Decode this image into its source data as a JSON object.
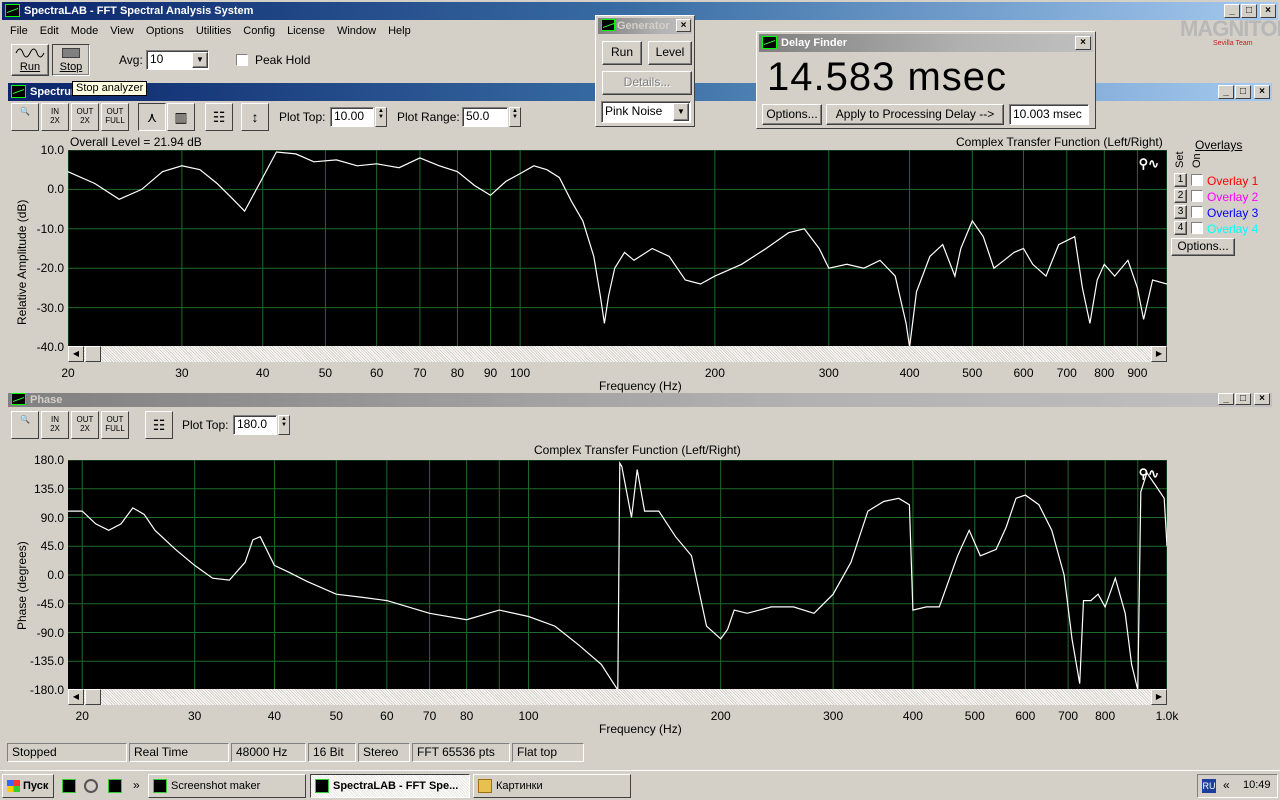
{
  "app": {
    "title": "SpectraLAB - FFT Spectral Analysis System",
    "logo": "MAGNITOLA",
    "logo_sub": "Sevilla Team"
  },
  "menu": [
    "File",
    "Edit",
    "Mode",
    "View",
    "Options",
    "Utilities",
    "Config",
    "License",
    "Window",
    "Help"
  ],
  "toolbar": {
    "run_label": "Run",
    "stop_label": "Stop",
    "avg_label": "Avg:",
    "avg_value": "10",
    "peak_hold_label": "Peak Hold",
    "tooltip": "Stop analyzer"
  },
  "generator": {
    "title": "Generator",
    "run_label": "Run",
    "level_label": "Level",
    "details_label": "Details...",
    "noise_value": "Pink Noise"
  },
  "delay_finder": {
    "title": "Delay Finder",
    "value": "14.583 msec",
    "options_label": "Options...",
    "apply_label": "Apply to Processing Delay -->",
    "processing_delay": "10.003 msec"
  },
  "spectrum": {
    "title": "Spectrum",
    "plot_top_label": "Plot Top:",
    "plot_top_value": "10.00",
    "plot_range_label": "Plot Range:",
    "plot_range_value": "50.0",
    "overall_level": "Overall Level = 21.94 dB",
    "subtitle": "Complex Transfer Function (Left/Right)",
    "overlays": {
      "title": "Overlays",
      "set_label": "Set",
      "on_label": "On",
      "items": [
        {
          "num": "1",
          "label": "Overlay 1",
          "color": "#ff0000"
        },
        {
          "num": "2",
          "label": "Overlay 2",
          "color": "#ff00ff"
        },
        {
          "num": "3",
          "label": "Overlay 3",
          "color": "#0000ff"
        },
        {
          "num": "4",
          "label": "Overlay 4",
          "color": "#00ffff"
        }
      ],
      "options_label": "Options..."
    }
  },
  "phase": {
    "title": "Phase",
    "plot_top_label": "Plot Top:",
    "plot_top_value": "180.0",
    "subtitle": "Complex Transfer Function (Left/Right)"
  },
  "status": [
    "Stopped",
    "Real Time",
    "48000 Hz",
    "16 Bit",
    "Stereo",
    "FFT 65536 pts",
    "Flat top"
  ],
  "taskbar": {
    "start_label": "Пуск",
    "tasks": [
      "Screenshot maker",
      "SpectraLAB - FFT Spe...",
      "Картинки"
    ],
    "lang": "RU",
    "clock": "10:49"
  },
  "chart_data": [
    {
      "type": "line",
      "xlabel": "Frequency (Hz)",
      "ylabel": "Relative Amplitude (dB)",
      "x_scale": "log",
      "xlim": [
        20,
        1000
      ],
      "ylim": [
        -40,
        10
      ],
      "grid": true,
      "x_ticks": [
        "20",
        "30",
        "40",
        "50",
        "60",
        "70",
        "80",
        "90",
        "100",
        "200",
        "300",
        "400",
        "500",
        "600",
        "700",
        "800",
        "900"
      ],
      "y_ticks": [
        "10.0",
        "0.0",
        "-10.0",
        "-20.0",
        "-30.0",
        "-40.0"
      ],
      "points": [
        [
          20,
          4.5
        ],
        [
          22,
          1.5
        ],
        [
          24,
          -2.5
        ],
        [
          26,
          0
        ],
        [
          28,
          4.5
        ],
        [
          30,
          6
        ],
        [
          32,
          5
        ],
        [
          34,
          1.5
        ],
        [
          36,
          -2.5
        ],
        [
          37.5,
          -5.5
        ],
        [
          40,
          3
        ],
        [
          42,
          9.5
        ],
        [
          45,
          9
        ],
        [
          48,
          7
        ],
        [
          52,
          7.5
        ],
        [
          56,
          6
        ],
        [
          60,
          6.5
        ],
        [
          65,
          5.5
        ],
        [
          70,
          8
        ],
        [
          75,
          6
        ],
        [
          80,
          4.5
        ],
        [
          85,
          1
        ],
        [
          90,
          -1.5
        ],
        [
          95,
          2
        ],
        [
          100,
          4
        ],
        [
          105,
          6
        ],
        [
          110,
          5
        ],
        [
          115,
          3
        ],
        [
          120,
          -3
        ],
        [
          125,
          -8
        ],
        [
          130,
          -17
        ],
        [
          133,
          -27
        ],
        [
          135,
          -34
        ],
        [
          137,
          -27
        ],
        [
          140,
          -20
        ],
        [
          145,
          -16
        ],
        [
          150,
          -18
        ],
        [
          160,
          -15
        ],
        [
          170,
          -17
        ],
        [
          180,
          -23
        ],
        [
          190,
          -24
        ],
        [
          200,
          -22
        ],
        [
          220,
          -19
        ],
        [
          240,
          -15
        ],
        [
          260,
          -11
        ],
        [
          275,
          -10
        ],
        [
          290,
          -15
        ],
        [
          300,
          -20
        ],
        [
          320,
          -19
        ],
        [
          340,
          -20
        ],
        [
          360,
          -18
        ],
        [
          380,
          -22
        ],
        [
          395,
          -34
        ],
        [
          400,
          -40
        ],
        [
          410,
          -26
        ],
        [
          430,
          -17
        ],
        [
          450,
          -14
        ],
        [
          470,
          -22
        ],
        [
          480,
          -15
        ],
        [
          500,
          -8
        ],
        [
          520,
          -12
        ],
        [
          540,
          -20
        ],
        [
          560,
          -18
        ],
        [
          580,
          -16
        ],
        [
          600,
          -15
        ],
        [
          620,
          -19
        ],
        [
          650,
          -22
        ],
        [
          680,
          -14
        ],
        [
          720,
          -12
        ],
        [
          740,
          -25
        ],
        [
          760,
          -34
        ],
        [
          780,
          -23
        ],
        [
          800,
          -19
        ],
        [
          830,
          -22
        ],
        [
          870,
          -18
        ],
        [
          900,
          -25
        ],
        [
          920,
          -33
        ],
        [
          950,
          -23
        ],
        [
          1000,
          -24
        ]
      ]
    },
    {
      "type": "line",
      "xlabel": "Frequency (Hz)",
      "ylabel": "Phase (degrees)",
      "x_scale": "log",
      "xlim": [
        19,
        1000
      ],
      "ylim": [
        -180,
        180
      ],
      "grid": true,
      "x_ticks": [
        "20",
        "30",
        "40",
        "50",
        "60",
        "70",
        "80",
        "100",
        "200",
        "300",
        "400",
        "500",
        "600",
        "700",
        "800",
        "1.0k"
      ],
      "y_ticks": [
        "180.0",
        "135.0",
        "90.0",
        "45.0",
        "0.0",
        "-45.0",
        "-90.0",
        "-135.0",
        "-180.0"
      ],
      "points": [
        [
          19,
          100
        ],
        [
          20,
          100
        ],
        [
          21,
          80
        ],
        [
          22,
          70
        ],
        [
          23,
          80
        ],
        [
          24,
          105
        ],
        [
          25,
          95
        ],
        [
          26,
          70
        ],
        [
          28,
          40
        ],
        [
          30,
          15
        ],
        [
          32,
          -5
        ],
        [
          34,
          -8
        ],
        [
          36,
          20
        ],
        [
          37,
          55
        ],
        [
          38,
          60
        ],
        [
          40,
          15
        ],
        [
          42,
          5
        ],
        [
          45,
          -10
        ],
        [
          50,
          -30
        ],
        [
          55,
          -35
        ],
        [
          60,
          -40
        ],
        [
          70,
          -60
        ],
        [
          80,
          -70
        ],
        [
          90,
          -55
        ],
        [
          100,
          -65
        ],
        [
          110,
          -80
        ],
        [
          120,
          -110
        ],
        [
          130,
          -140
        ],
        [
          138,
          -180
        ],
        [
          139,
          175
        ],
        [
          140,
          170
        ],
        [
          145,
          90
        ],
        [
          148,
          165
        ],
        [
          152,
          100
        ],
        [
          160,
          100
        ],
        [
          170,
          60
        ],
        [
          180,
          30
        ],
        [
          190,
          -80
        ],
        [
          200,
          -100
        ],
        [
          205,
          -85
        ],
        [
          210,
          -55
        ],
        [
          220,
          -60
        ],
        [
          240,
          -50
        ],
        [
          260,
          -50
        ],
        [
          280,
          -60
        ],
        [
          300,
          -30
        ],
        [
          320,
          20
        ],
        [
          340,
          100
        ],
        [
          360,
          115
        ],
        [
          380,
          120
        ],
        [
          395,
          110
        ],
        [
          400,
          -55
        ],
        [
          420,
          -50
        ],
        [
          440,
          -50
        ],
        [
          470,
          30
        ],
        [
          490,
          70
        ],
        [
          510,
          30
        ],
        [
          540,
          40
        ],
        [
          560,
          75
        ],
        [
          580,
          120
        ],
        [
          600,
          125
        ],
        [
          630,
          110
        ],
        [
          660,
          70
        ],
        [
          690,
          0
        ],
        [
          710,
          -100
        ],
        [
          730,
          -170
        ],
        [
          740,
          -40
        ],
        [
          760,
          -40
        ],
        [
          780,
          -30
        ],
        [
          800,
          -50
        ],
        [
          830,
          -5
        ],
        [
          860,
          -60
        ],
        [
          880,
          -140
        ],
        [
          900,
          -180
        ],
        [
          910,
          130
        ],
        [
          930,
          160
        ],
        [
          960,
          140
        ],
        [
          990,
          120
        ],
        [
          1000,
          45
        ]
      ]
    }
  ]
}
